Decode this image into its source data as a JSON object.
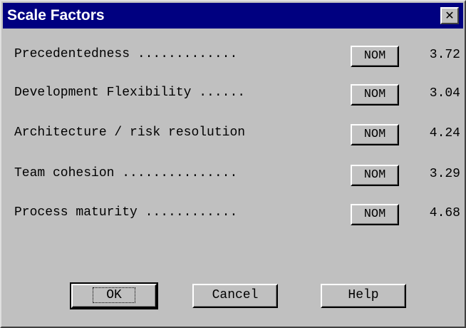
{
  "window": {
    "title": "Scale Factors",
    "close_glyph": "✕"
  },
  "factors": [
    {
      "label": "Precedentedness .............",
      "rating": "NOM",
      "value": "3.72"
    },
    {
      "label": "Development Flexibility ......",
      "rating": "NOM",
      "value": "3.04"
    },
    {
      "label": "Architecture / risk resolution",
      "rating": "NOM",
      "value": "4.24"
    },
    {
      "label": "Team cohesion ...............",
      "rating": "NOM",
      "value": "3.29"
    },
    {
      "label": "Process maturity ............",
      "rating": "NOM",
      "value": "4.68"
    }
  ],
  "buttons": {
    "ok": "OK",
    "cancel": "Cancel",
    "help": "Help"
  },
  "colors": {
    "titlebar": "#000080",
    "face": "#c0c0c0"
  }
}
